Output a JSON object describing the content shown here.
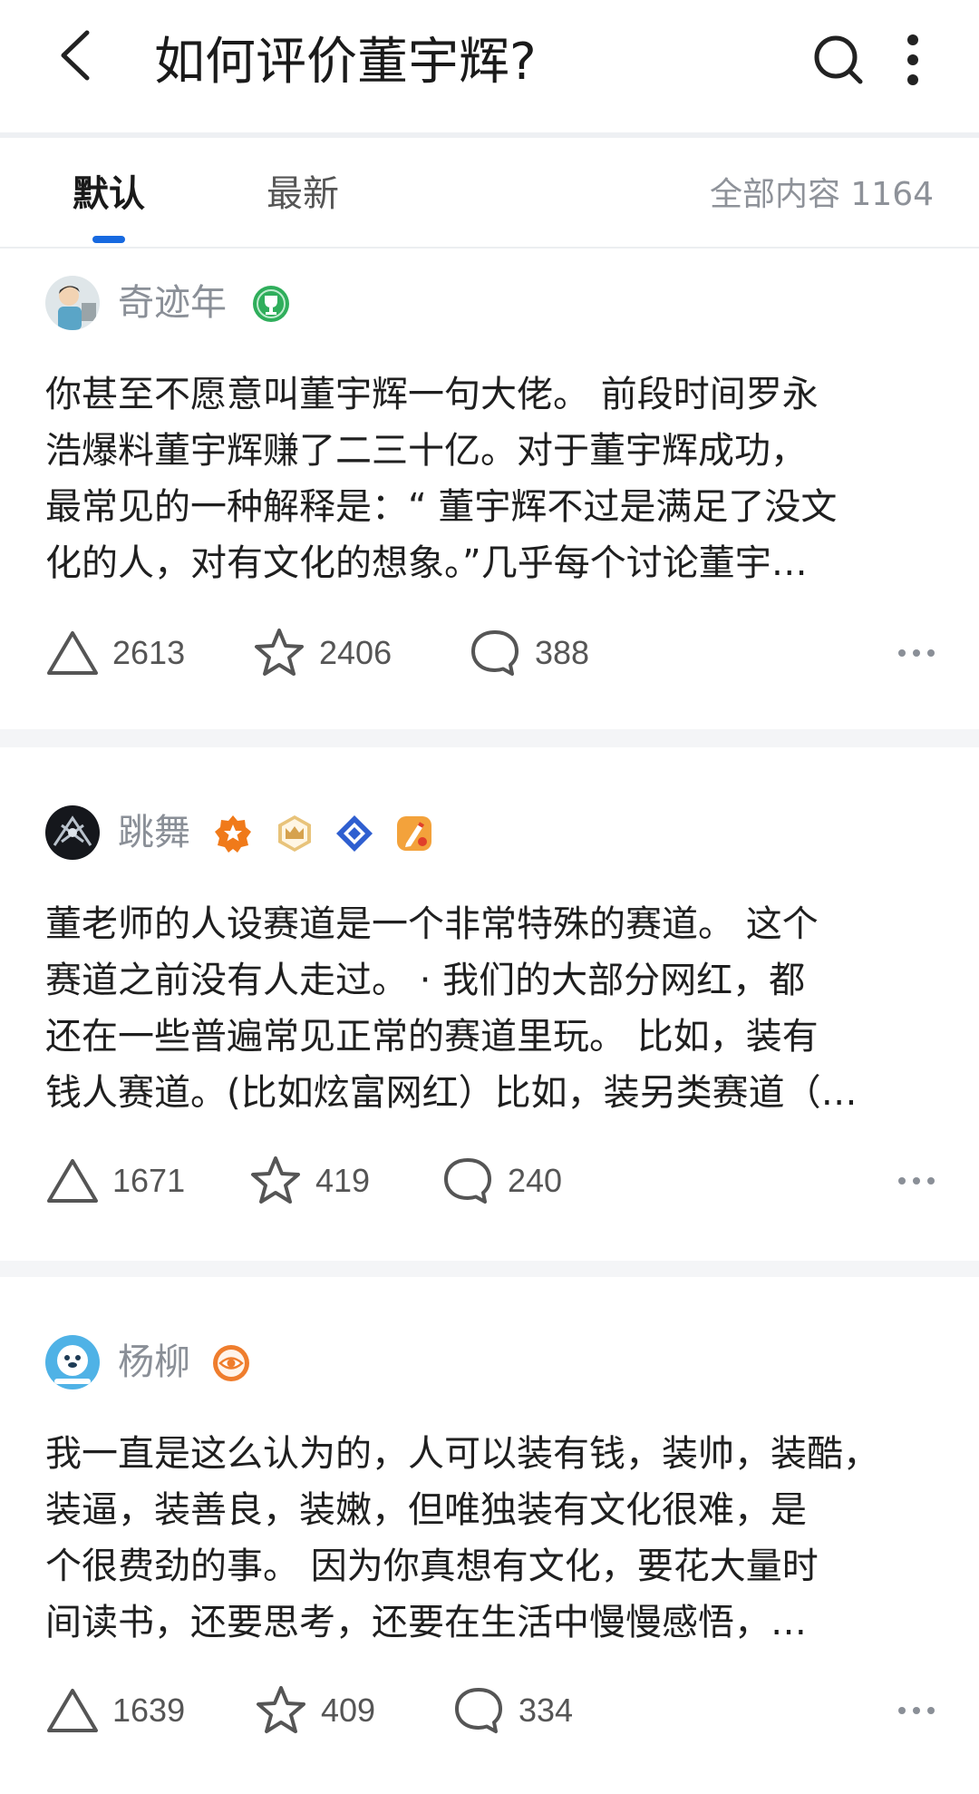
{
  "header": {
    "title": "如何评价董宇辉?"
  },
  "tabs": [
    {
      "label": "默认",
      "active": true
    },
    {
      "label": "最新",
      "active": false
    }
  ],
  "count_label": "全部内容 1164",
  "answers": [
    {
      "author": "奇迹年",
      "excerpt_lines": [
        "你甚至不愿意叫董宇辉一句大佬。 前段时间罗永",
        "浩爆料董宇辉赚了二三十亿。对于董宇辉成功，",
        "最常见的一种解释是：“ 董宇辉不过是满足了没文",
        "化的人，对有文化的想象。”几乎每个讨论董宇…"
      ],
      "likes": "2613",
      "favorites": "2406",
      "comments": "388"
    },
    {
      "author": "跳舞",
      "excerpt_lines": [
        "董老师的人设赛道是一个非常特殊的赛道。 这个",
        "赛道之前没有人走过。 · 我们的大部分网红，都",
        "还在一些普遍常见正常的赛道里玩。 比如，装有",
        "钱人赛道。(比如炫富网红）比如，装另类赛道（…"
      ],
      "likes": "1671",
      "favorites": "419",
      "comments": "240"
    },
    {
      "author": "杨柳",
      "excerpt_lines": [
        "我一直是这么认为的，人可以装有钱，装帅，装酷，",
        "装逼，装善良，装嫩，但唯独装有文化很难，是",
        "个很费劲的事。 因为你真想有文化，要花大量时",
        "间读书，还要思考，还要在生活中慢慢感悟，…"
      ],
      "likes": "1639",
      "favorites": "409",
      "comments": "334"
    }
  ],
  "colors": {
    "accent": "#1769e0",
    "text": "#1f1f1f",
    "muted": "#8a8f97",
    "background": "#f4f5f7"
  }
}
